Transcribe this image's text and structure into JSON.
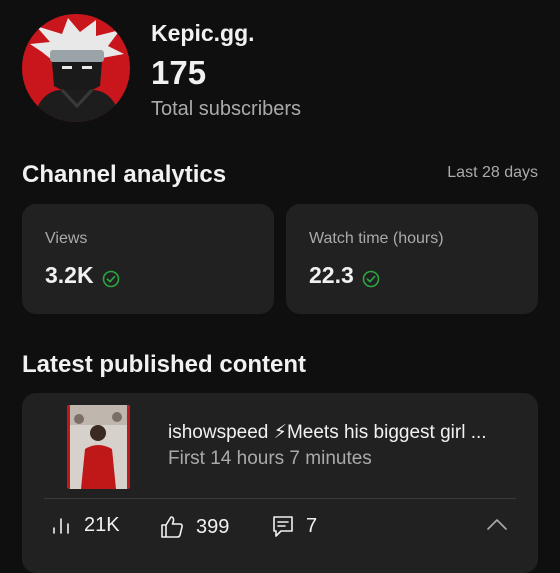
{
  "channel": {
    "name": "Kepic.gg.",
    "subscriber_count": "175",
    "subscriber_label": "Total subscribers"
  },
  "analytics": {
    "title": "Channel analytics",
    "period": "Last 28 days",
    "cards": [
      {
        "label": "Views",
        "value": "3.2K"
      },
      {
        "label": "Watch time (hours)",
        "value": "22.3"
      }
    ]
  },
  "latest": {
    "title": "Latest published content",
    "video": {
      "title": "ishowspeed ⚡Meets his biggest girl ...",
      "subtitle": "First 14 hours 7 minutes",
      "views": "21K",
      "likes": "399",
      "comments": "7"
    }
  },
  "colors": {
    "background": "#0f0f0f",
    "card": "#212121",
    "check": "#2ba640",
    "avatar_red": "#c8161c"
  },
  "icons": [
    "check-circle-icon",
    "bar-chart-icon",
    "thumbs-up-icon",
    "comment-icon",
    "chevron-up-icon"
  ]
}
